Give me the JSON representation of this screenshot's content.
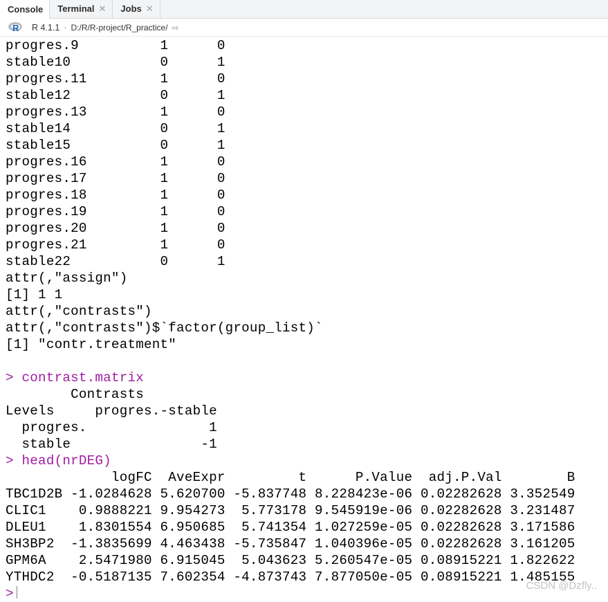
{
  "tabs": [
    {
      "label": "Console",
      "closable": false,
      "active": true
    },
    {
      "label": "Terminal",
      "closable": true,
      "active": false
    },
    {
      "label": "Jobs",
      "closable": true,
      "active": false
    }
  ],
  "pathbar": {
    "r_version": "R 4.1.1",
    "separator": "·",
    "path": "D:/R/R-project/R_practice/",
    "go_icon": "⇨"
  },
  "console": {
    "lines": [
      {
        "type": "output",
        "text": "progres.9          1      0"
      },
      {
        "type": "output",
        "text": "stable10           0      1"
      },
      {
        "type": "output",
        "text": "progres.11         1      0"
      },
      {
        "type": "output",
        "text": "stable12           0      1"
      },
      {
        "type": "output",
        "text": "progres.13         1      0"
      },
      {
        "type": "output",
        "text": "stable14           0      1"
      },
      {
        "type": "output",
        "text": "stable15           0      1"
      },
      {
        "type": "output",
        "text": "progres.16         1      0"
      },
      {
        "type": "output",
        "text": "progres.17         1      0"
      },
      {
        "type": "output",
        "text": "progres.18         1      0"
      },
      {
        "type": "output",
        "text": "progres.19         1      0"
      },
      {
        "type": "output",
        "text": "progres.20         1      0"
      },
      {
        "type": "output",
        "text": "progres.21         1      0"
      },
      {
        "type": "output",
        "text": "stable22           0      1"
      },
      {
        "type": "output",
        "text": "attr(,\"assign\")"
      },
      {
        "type": "output",
        "text": "[1] 1 1"
      },
      {
        "type": "output",
        "text": "attr(,\"contrasts\")"
      },
      {
        "type": "output",
        "text": "attr(,\"contrasts\")$`factor(group_list)`"
      },
      {
        "type": "output",
        "text": "[1] \"contr.treatment\""
      },
      {
        "type": "output",
        "text": ""
      },
      {
        "type": "command",
        "prompt": "> ",
        "text": "contrast.matrix"
      },
      {
        "type": "output",
        "text": "        Contrasts"
      },
      {
        "type": "output",
        "text": "Levels     progres.-stable"
      },
      {
        "type": "output",
        "text": "  progres.               1"
      },
      {
        "type": "output",
        "text": "  stable                -1"
      },
      {
        "type": "command",
        "prompt": "> ",
        "text": "head(nrDEG)"
      },
      {
        "type": "output",
        "text": "             logFC  AveExpr         t      P.Value  adj.P.Val        B"
      },
      {
        "type": "output",
        "text": "TBC1D2B -1.0284628 5.620700 -5.837748 8.228423e-06 0.02282628 3.352549"
      },
      {
        "type": "output",
        "text": "CLIC1    0.9888221 9.954273  5.773178 9.545919e-06 0.02282628 3.231487"
      },
      {
        "type": "output",
        "text": "DLEU1    1.8301554 6.950685  5.741354 1.027259e-05 0.02282628 3.171586"
      },
      {
        "type": "output",
        "text": "SH3BP2  -1.3835699 4.463438 -5.735847 1.040396e-05 0.02282628 3.161205"
      },
      {
        "type": "output",
        "text": "GPM6A    2.5471980 6.915045  5.043623 5.260547e-05 0.08915221 1.822622"
      },
      {
        "type": "output",
        "text": "YTHDC2  -0.5187135 7.602354 -4.873743 7.877050e-05 0.08915221 1.485155"
      }
    ],
    "input_prompt": ">"
  },
  "watermark": "CSDN @Dzfly.."
}
